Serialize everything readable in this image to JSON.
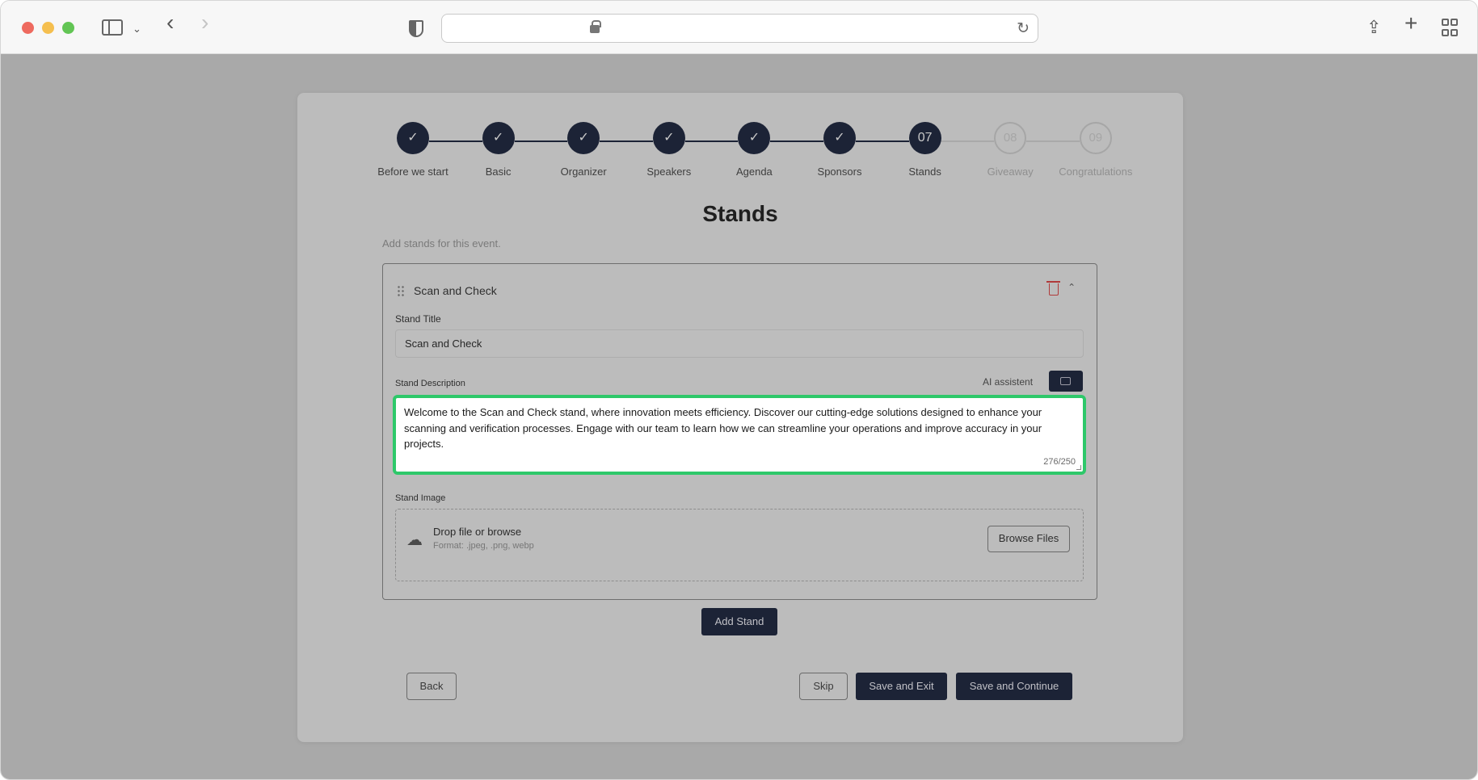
{
  "browser": {
    "address": ""
  },
  "stepper": {
    "steps": [
      {
        "marker": "✓",
        "label": "Before we start",
        "state": "done"
      },
      {
        "marker": "✓",
        "label": "Basic",
        "state": "done"
      },
      {
        "marker": "✓",
        "label": "Organizer",
        "state": "done"
      },
      {
        "marker": "✓",
        "label": "Speakers",
        "state": "done"
      },
      {
        "marker": "✓",
        "label": "Agenda",
        "state": "done"
      },
      {
        "marker": "✓",
        "label": "Sponsors",
        "state": "done"
      },
      {
        "marker": "07",
        "label": "Stands",
        "state": "current"
      },
      {
        "marker": "08",
        "label": "Giveaway",
        "state": "pending"
      },
      {
        "marker": "09",
        "label": "Congratulations",
        "state": "pending"
      }
    ]
  },
  "page": {
    "title": "Stands",
    "subtitle": "Add stands for this event."
  },
  "stand": {
    "name": "Scan and Check",
    "title_label": "Stand Title",
    "title_value": "Scan and Check",
    "description_label": "Stand Description",
    "ai_label": "AI assistent",
    "description_value": "Welcome to the Scan and Check stand, where innovation meets efficiency. Discover our cutting-edge solutions designed to enhance your scanning and verification processes. Engage with our team to learn how we can streamline your operations and improve accuracy in your projects.",
    "char_count": "276/250",
    "image_label": "Stand Image",
    "drop_title": "Drop file or browse",
    "drop_hint": "Format: .jpeg, .png, webp",
    "browse_label": "Browse Files"
  },
  "actions": {
    "add_stand": "Add Stand",
    "back": "Back",
    "skip": "Skip",
    "save_exit": "Save and Exit",
    "save_continue": "Save and Continue"
  },
  "colors": {
    "primary": "#1c2336",
    "focus_ring": "#2ec86a",
    "danger": "#b03a3a"
  }
}
